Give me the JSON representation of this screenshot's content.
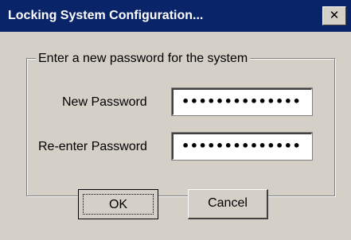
{
  "window": {
    "title": "Locking System Configuration...",
    "close_glyph": "✕"
  },
  "group": {
    "label": "Enter a new password for the system"
  },
  "fields": {
    "new_password": {
      "label": "New Password",
      "value": "••••••••••••••"
    },
    "reenter_password": {
      "label": "Re-enter Password",
      "value": "••••••••••••••"
    }
  },
  "buttons": {
    "ok": "OK",
    "cancel": "Cancel"
  },
  "colors": {
    "titlebar": "#0a246a",
    "face": "#d4d0c8"
  }
}
